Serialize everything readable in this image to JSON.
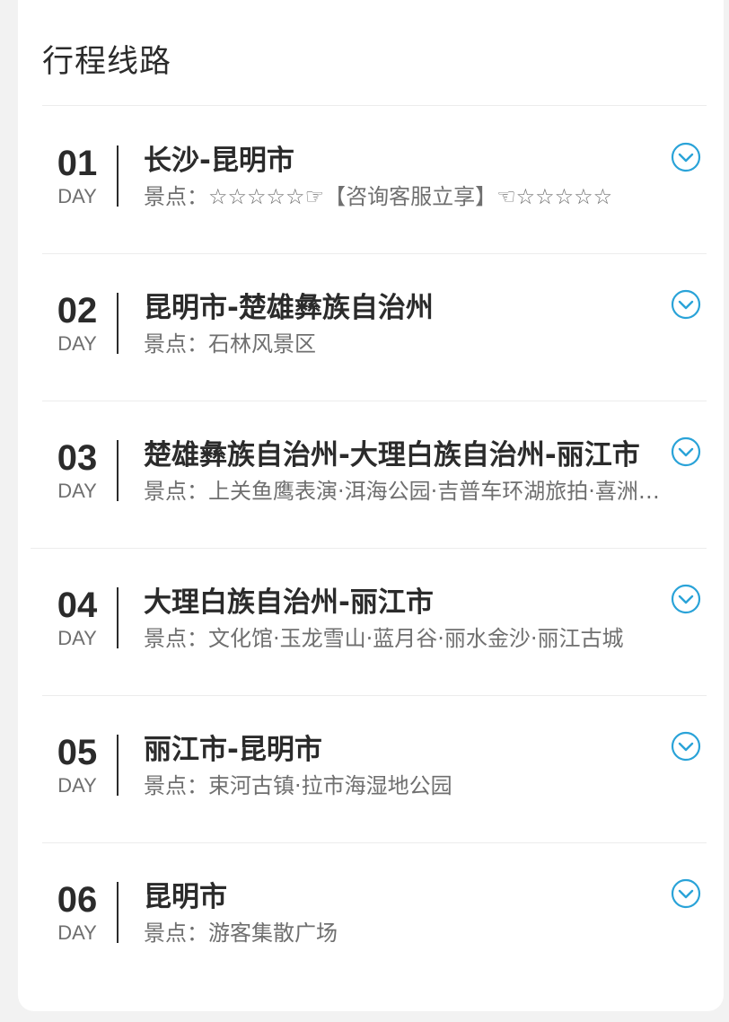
{
  "section": {
    "title": "行程线路"
  },
  "colors": {
    "accent": "#2aa3d8",
    "text_primary": "#2b2b2b",
    "text_secondary": "#6f6f6f",
    "divider": "#ececec",
    "page_bg": "#f2f2f2",
    "card_bg": "#ffffff"
  },
  "itinerary": {
    "spots_prefix": "景点：",
    "expand_icon": "chevron-down-circle-icon",
    "days": [
      {
        "num": "01",
        "day_label": "DAY",
        "title": "长沙-昆明市",
        "spots_text": "景点：☆☆☆☆☆☞【咨询客服立享】☜☆☆☆☆☆"
      },
      {
        "num": "02",
        "day_label": "DAY",
        "title": "昆明市-楚雄彝族自治州",
        "spots_text": "景点：石林风景区"
      },
      {
        "num": "03",
        "day_label": "DAY",
        "title": "楚雄彝族自治州-大理白族自治州-丽江市",
        "spots_text": "景点：上关鱼鹰表演·洱海公园·吉普车环湖旅拍·喜洲古镇"
      },
      {
        "num": "04",
        "day_label": "DAY",
        "title": "大理白族自治州-丽江市",
        "spots_text": "景点：文化馆·玉龙雪山·蓝月谷·丽水金沙·丽江古城"
      },
      {
        "num": "05",
        "day_label": "DAY",
        "title": "丽江市-昆明市",
        "spots_text": "景点：束河古镇·拉市海湿地公园"
      },
      {
        "num": "06",
        "day_label": "DAY",
        "title": "昆明市",
        "spots_text": "景点：游客集散广场"
      }
    ]
  }
}
